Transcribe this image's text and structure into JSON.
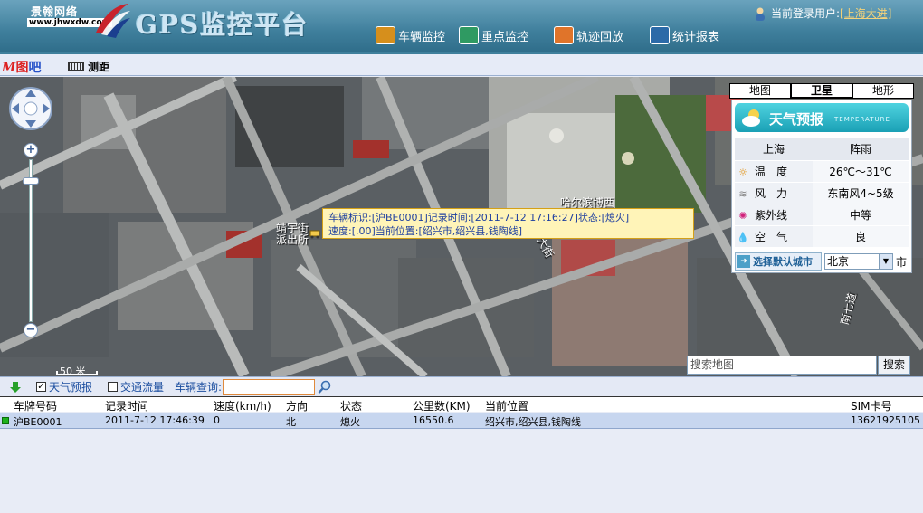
{
  "header": {
    "logo_name": "景翰网络",
    "logo_url": "www.jhwxdw.com",
    "app_title": "GPS监控平台",
    "nav": [
      {
        "label": "车辆监控",
        "icon": "vehicle-monitor-icon",
        "color": "#d68f1c"
      },
      {
        "label": "重点监控",
        "icon": "key-monitor-icon",
        "color": "#2f9a62"
      },
      {
        "label": "轨迹回放",
        "icon": "track-playback-icon",
        "color": "#e0742a"
      },
      {
        "label": "统计报表",
        "icon": "report-icon",
        "color": "#2c6aa8"
      }
    ],
    "user_label": "当前登录用户:",
    "user_name": "[上海大进]"
  },
  "toolbar": {
    "brand_m": "M",
    "brand_zi": "图",
    "brand_ba": "吧",
    "measure_label": "测距"
  },
  "map": {
    "scale_label": "50 米",
    "labels": [
      {
        "text": "靖宇街\n派出所"
      },
      {
        "text": "哈尔滨博西"
      },
      {
        "text": "大街"
      },
      {
        "text": "南七道"
      }
    ],
    "tooltip": {
      "line1": "车辆标识:[沪BE0001]记录时间:[2011-7-12 17:16:27]状态:[熄火]",
      "line2": "速度:[.00]当前位置:[绍兴市,绍兴县,钱陶线]"
    },
    "map_types": [
      "地图",
      "卫星",
      "地形"
    ],
    "active_map_type": 1,
    "search_placeholder": "搜索地图",
    "search_button": "搜索"
  },
  "weather": {
    "title": "天气预报",
    "subtitle": "TEMPERATURE",
    "city": "上海",
    "condition": "阵雨",
    "rows": [
      {
        "icon": "sun-icon",
        "label": "温　度",
        "value": "26℃～31℃"
      },
      {
        "icon": "wind-icon",
        "label": "风　力",
        "value": "东南风4~5级"
      },
      {
        "icon": "uv-icon",
        "label": "紫外线",
        "value": "中等"
      },
      {
        "icon": "air-icon",
        "label": "空　气",
        "value": "良"
      }
    ],
    "select_city_button": "选择默认城市",
    "selected_city": "北京",
    "city_suffix": "市"
  },
  "bottom_bar": {
    "weather_checkbox": "天气预报",
    "weather_checked": true,
    "traffic_checkbox": "交通流量",
    "traffic_checked": false,
    "vehicle_query_label": "车辆查询:",
    "vehicle_query_value": ""
  },
  "table": {
    "columns": [
      "车牌号码",
      "记录时间",
      "速度(km/h)",
      "方向",
      "状态",
      "公里数(KM)",
      "当前位置",
      "SIM卡号"
    ],
    "rows": [
      {
        "plate": "沪BE0001",
        "time": "2011-7-12 17:46:39",
        "speed": "0",
        "direction": "北",
        "status": "熄火",
        "km": "16550.6",
        "location": "绍兴市,绍兴县,钱陶线",
        "sim": "13621925105"
      }
    ]
  },
  "colors": {
    "header_bg": "#3f7f9c",
    "accent_link": "#f4d27a",
    "selected_row": "#c7d6ef",
    "status_online": "#1db21d"
  }
}
